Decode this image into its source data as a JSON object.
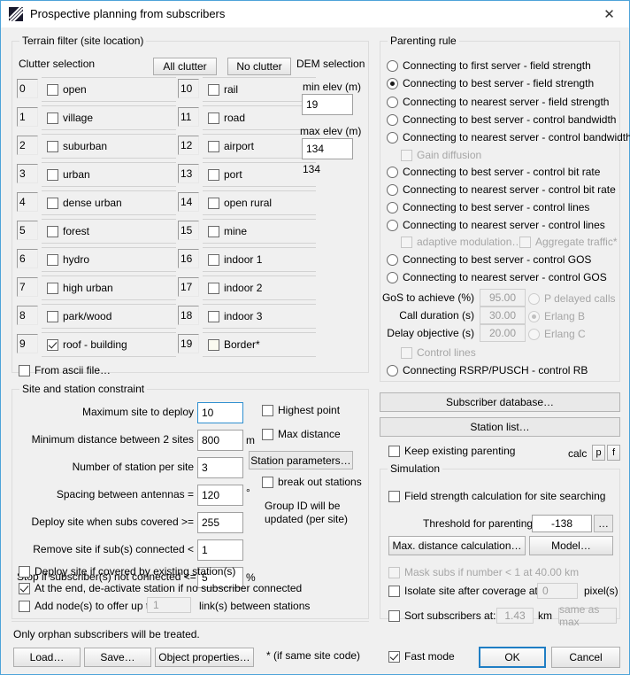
{
  "window": {
    "title": "Prospective planning from subscribers",
    "icon": "hatched-square-icon",
    "close_label": "✕",
    "accent_color": "#4da3d9"
  },
  "terrain_filter": {
    "legend": "Terrain filter (site location)",
    "clutter_label": "Clutter selection",
    "all_clutter_button": "All clutter",
    "no_clutter_button": "No clutter",
    "from_ascii_checkbox": {
      "label": "From ascii file…",
      "checked": false
    },
    "clutter_left": [
      {
        "num": "0",
        "label": "open",
        "checked": false
      },
      {
        "num": "1",
        "label": "village",
        "checked": false
      },
      {
        "num": "2",
        "label": "suburban",
        "checked": false
      },
      {
        "num": "3",
        "label": "urban",
        "checked": false
      },
      {
        "num": "4",
        "label": "dense urban",
        "checked": false
      },
      {
        "num": "5",
        "label": "forest",
        "checked": false
      },
      {
        "num": "6",
        "label": "hydro",
        "checked": false
      },
      {
        "num": "7",
        "label": "high urban",
        "checked": false
      },
      {
        "num": "8",
        "label": "park/wood",
        "checked": false
      },
      {
        "num": "9",
        "label": "roof - building",
        "checked": true
      }
    ],
    "clutter_right": [
      {
        "num": "10",
        "label": "rail",
        "checked": false
      },
      {
        "num": "11",
        "label": "road",
        "checked": false
      },
      {
        "num": "12",
        "label": "airport",
        "checked": false
      },
      {
        "num": "13",
        "label": "port",
        "checked": false
      },
      {
        "num": "14",
        "label": "open rural",
        "checked": false
      },
      {
        "num": "15",
        "label": "mine",
        "checked": false
      },
      {
        "num": "16",
        "label": "indoor 1",
        "checked": false
      },
      {
        "num": "17",
        "label": "indoor 2",
        "checked": false
      },
      {
        "num": "18",
        "label": "indoor 3",
        "checked": false
      },
      {
        "num": "19",
        "label": "Border*",
        "checked": false
      }
    ],
    "dem": {
      "label": "DEM selection",
      "min_elev_label": "min elev (m)",
      "min_elev_value": "19",
      "max_elev_label": "max elev (m)",
      "max_elev_value": "134",
      "max_elev_note": "134"
    }
  },
  "site_constraint": {
    "legend": "Site and station constraint",
    "rows": [
      {
        "label": "Maximum site to deploy",
        "value": "10",
        "unit": ""
      },
      {
        "label": "Minimum distance between 2 sites",
        "value": "800",
        "unit": "m"
      },
      {
        "label": "Number of station per site",
        "value": "3",
        "unit": ""
      },
      {
        "label": "Spacing between antennas =",
        "value": "120",
        "unit": "°"
      },
      {
        "label": "Deploy site when subs covered >=",
        "value": "255",
        "unit": ""
      },
      {
        "label": "Remove site if sub(s) connected <",
        "value": "1",
        "unit": ""
      },
      {
        "label": "Stop if subscriber(s) not connected <=",
        "value": "5",
        "unit": "%"
      }
    ],
    "highest_point": {
      "label": "Highest point",
      "checked": false
    },
    "max_distance": {
      "label": "Max distance",
      "checked": false
    },
    "station_parameters_button": "Station parameters…",
    "break_out_stations": {
      "label": "break out stations",
      "checked": false
    },
    "group_id_note_line1": "Group ID will be",
    "group_id_note_line2": "updated (per site)",
    "deploy_if_covered": {
      "label": "Deploy site if covered by existing station(s)",
      "checked": false
    },
    "deactivate_station": {
      "label": "At the end, de-activate station if no subscriber connected",
      "checked": true
    },
    "add_nodes": {
      "label_before": "Add node(s) to offer up to",
      "value": "1",
      "label_after": "link(s) between stations",
      "checked": false
    }
  },
  "parenting_rule": {
    "legend": "Parenting rule",
    "options": [
      {
        "label": "Connecting to first server - field strength",
        "selected": false,
        "disabled": false
      },
      {
        "label": "Connecting to best server - field strength",
        "selected": true,
        "disabled": false
      },
      {
        "label": "Connecting to nearest server - field strength",
        "selected": false,
        "disabled": false
      },
      {
        "label": "Connecting to best server - control bandwidth",
        "selected": false,
        "disabled": false
      },
      {
        "label": "Connecting to nearest server - control bandwidth",
        "selected": false,
        "disabled": false
      },
      {
        "label": "Connecting to best server - control bit rate",
        "selected": false,
        "disabled": false
      },
      {
        "label": "Connecting to nearest server - control bit rate",
        "selected": false,
        "disabled": false
      },
      {
        "label": "Connecting to best server - control lines",
        "selected": false,
        "disabled": false
      },
      {
        "label": "Connecting to nearest server - control lines",
        "selected": false,
        "disabled": false
      },
      {
        "label": "Connecting to best server - control GOS",
        "selected": false,
        "disabled": false
      },
      {
        "label": "Connecting to nearest server - control GOS",
        "selected": false,
        "disabled": false
      },
      {
        "label": "Connecting RSRP/PUSCH - control RB",
        "selected": false,
        "disabled": false
      }
    ],
    "gain_diffusion": {
      "label": "Gain diffusion",
      "checked": false,
      "disabled": true
    },
    "adaptive_modulation": {
      "label": "adaptive modulation…",
      "checked": false,
      "disabled": true
    },
    "aggregate_traffic": {
      "label": "Aggregate traffic*",
      "checked": false,
      "disabled": true
    },
    "gos": {
      "gos_label": "GoS to achieve (%)",
      "gos_value": "95.00",
      "call_label": "Call duration (s)",
      "call_value": "30.00",
      "delay_label": "Delay objective (s)",
      "delay_value": "20.00",
      "radios": [
        {
          "label": "P delayed calls",
          "selected": false
        },
        {
          "label": "Erlang B",
          "selected": true
        },
        {
          "label": "Erlang C",
          "selected": false
        }
      ],
      "control_lines": {
        "label": "Control lines",
        "checked": false
      }
    }
  },
  "right_panel": {
    "subscriber_database_button": "Subscriber database…",
    "station_list_button": "Station list…",
    "keep_parenting": {
      "label": "Keep existing parenting",
      "checked": false
    },
    "calc_label": "calc",
    "calc_p_button": "p",
    "calc_f_button": "f",
    "simulation_legend": "Simulation",
    "field_strength": {
      "label": "Field strength calculation for site searching",
      "checked": false
    },
    "threshold_label": "Threshold for parenting",
    "threshold_value": "-138",
    "threshold_ellipsis_button": "…",
    "max_distance_button": "Max. distance calculation…",
    "model_button": "Model…",
    "mask_subs": {
      "label": "Mask subs if number < 1 at 40.00 km",
      "checked": false,
      "disabled": true
    },
    "isolate_site": {
      "label": "Isolate site after coverage at",
      "value": "0",
      "unit": "pixel(s)",
      "checked": false
    },
    "sort_subscribers": {
      "label": "Sort subscribers at:",
      "value": "1.43",
      "unit": "km",
      "button": "same as max",
      "checked": false
    }
  },
  "footer": {
    "note": "Only orphan subscribers will be treated.",
    "load_button": "Load…",
    "save_button": "Save…",
    "object_properties_button": "Object properties…",
    "footnote": "* (if same site code)",
    "fast_mode": {
      "label": "Fast mode",
      "checked": true
    },
    "ok_button": "OK",
    "cancel_button": "Cancel"
  }
}
